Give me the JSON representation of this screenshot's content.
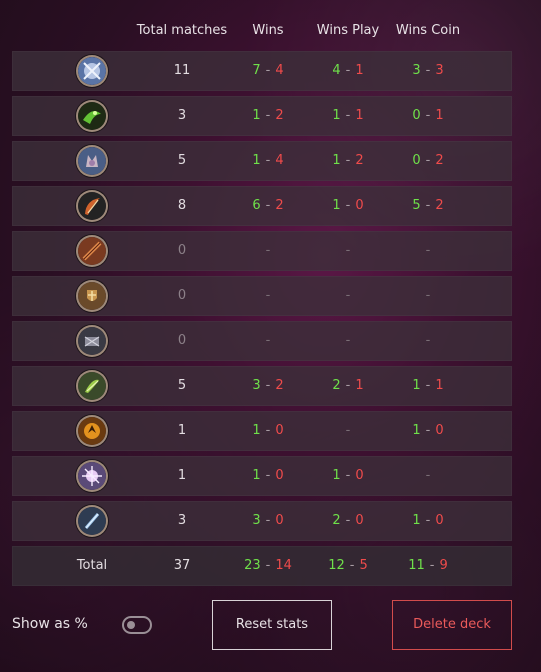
{
  "headers": {
    "total_matches": "Total matches",
    "wins": "Wins",
    "wins_play": "Wins Play",
    "wins_coin": "Wins Coin"
  },
  "rows": [
    {
      "icon": "mage-class-icon",
      "total": "11",
      "wins": {
        "w": "7",
        "l": "4"
      },
      "play": {
        "w": "4",
        "l": "1"
      },
      "coin": {
        "w": "3",
        "l": "3"
      }
    },
    {
      "icon": "demon-hunter-class-icon",
      "total": "3",
      "wins": {
        "w": "1",
        "l": "2"
      },
      "play": {
        "w": "1",
        "l": "1"
      },
      "coin": {
        "w": "0",
        "l": "1"
      }
    },
    {
      "icon": "shaman-class-icon",
      "total": "5",
      "wins": {
        "w": "1",
        "l": "4"
      },
      "play": {
        "w": "1",
        "l": "2"
      },
      "coin": {
        "w": "0",
        "l": "2"
      }
    },
    {
      "icon": "rogue-class-icon",
      "total": "8",
      "wins": {
        "w": "6",
        "l": "2"
      },
      "play": {
        "w": "1",
        "l": "0"
      },
      "coin": {
        "w": "5",
        "l": "2"
      }
    },
    {
      "icon": "warrior-class-icon",
      "total": "0",
      "wins": null,
      "play": null,
      "coin": null
    },
    {
      "icon": "paladin-class-icon",
      "total": "0",
      "wins": null,
      "play": null,
      "coin": null
    },
    {
      "icon": "warlock-class-icon",
      "total": "0",
      "wins": null,
      "play": null,
      "coin": null
    },
    {
      "icon": "hunter-class-icon",
      "total": "5",
      "wins": {
        "w": "3",
        "l": "2"
      },
      "play": {
        "w": "2",
        "l": "1"
      },
      "coin": {
        "w": "1",
        "l": "1"
      }
    },
    {
      "icon": "druid-class-icon",
      "total": "1",
      "wins": {
        "w": "1",
        "l": "0"
      },
      "play": null,
      "coin": {
        "w": "1",
        "l": "0"
      }
    },
    {
      "icon": "priest-class-icon",
      "total": "1",
      "wins": {
        "w": "1",
        "l": "0"
      },
      "play": {
        "w": "1",
        "l": "0"
      },
      "coin": null
    },
    {
      "icon": "death-knight-class-icon",
      "total": "3",
      "wins": {
        "w": "3",
        "l": "0"
      },
      "play": {
        "w": "2",
        "l": "0"
      },
      "coin": {
        "w": "1",
        "l": "0"
      }
    }
  ],
  "total_row": {
    "label": "Total",
    "total": "37",
    "wins": {
      "w": "23",
      "l": "14"
    },
    "play": {
      "w": "12",
      "l": "5"
    },
    "coin": {
      "w": "11",
      "l": "9"
    }
  },
  "dash": "-",
  "separator": "-",
  "controls": {
    "show_as_percent_label": "Show as %",
    "show_as_percent_value": false,
    "reset_label": "Reset stats",
    "delete_label": "Delete deck"
  },
  "colors": {
    "win": "#6fe04a",
    "loss": "#ef4b4b",
    "delete": "#ea5a5a"
  }
}
